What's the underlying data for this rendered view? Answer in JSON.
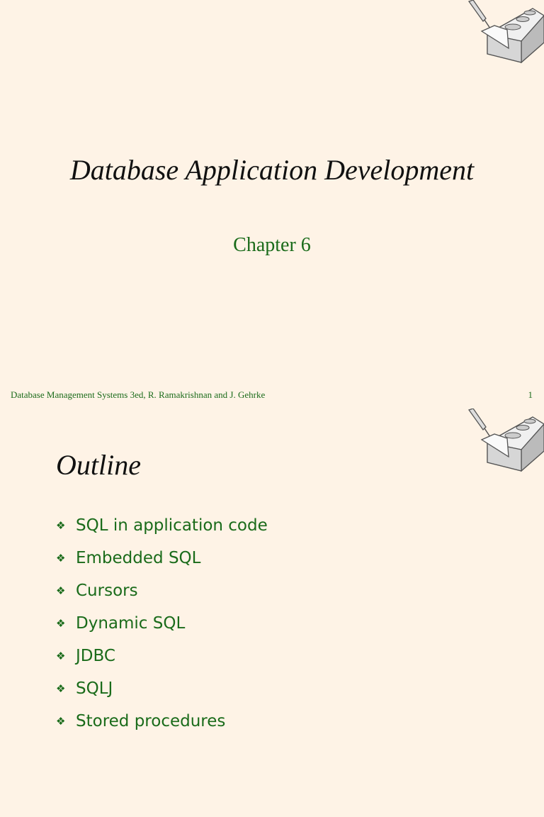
{
  "slide1": {
    "title": "Database Application Development",
    "subtitle": "Chapter 6",
    "footer": "Database Management Systems 3ed,  R. Ramakrishnan and J. Gehrke",
    "page_number": "1"
  },
  "slide2": {
    "title": "Outline",
    "bullets": [
      "SQL in application code",
      "Embedded SQL",
      "Cursors",
      "Dynamic SQL",
      "JDBC",
      "SQLJ",
      "Stored procedures"
    ],
    "bullet_icon": "diamond-bullet-icon"
  },
  "colors": {
    "background": "#fef3e6",
    "accent": "#1a6b1a"
  }
}
